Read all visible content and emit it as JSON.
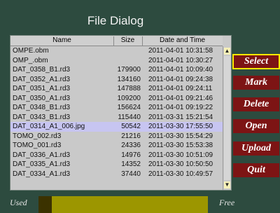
{
  "dialog": {
    "title": "File Dialog"
  },
  "table": {
    "headers": {
      "name": "Name",
      "size": "Size",
      "date": "Date and Time"
    },
    "rows": [
      {
        "name": "OMPE.obm",
        "size": "",
        "date": "2011-04-01 10:31:58"
      },
      {
        "name": "OMP_.obm",
        "size": "",
        "date": "2011-04-01 10:30:27"
      },
      {
        "name": "DAT_0358_B1.rd3",
        "size": "179900",
        "date": "2011-04-01 10:09:40"
      },
      {
        "name": "DAT_0352_A1.rd3",
        "size": "134160",
        "date": "2011-04-01 09:24:38"
      },
      {
        "name": "DAT_0351_A1.rd3",
        "size": "147888",
        "date": "2011-04-01 09:24:11"
      },
      {
        "name": "DAT_0350_A1.rd3",
        "size": "109200",
        "date": "2011-04-01 09:21:46"
      },
      {
        "name": "DAT_0348_B1.rd3",
        "size": "156624",
        "date": "2011-04-01 09:19:22"
      },
      {
        "name": "DAT_0343_B1.rd3",
        "size": "115440",
        "date": "2011-03-31 15:21:54"
      },
      {
        "name": "DAT_0314_A1_006.jpg",
        "size": "50542",
        "date": "2011-03-30 17:55:50"
      },
      {
        "name": "TOMO_002.rd3",
        "size": "21216",
        "date": "2011-03-30 15:54:29"
      },
      {
        "name": "TOMO_001.rd3",
        "size": "24336",
        "date": "2011-03-30 15:53:38"
      },
      {
        "name": "DAT_0336_A1.rd3",
        "size": "14976",
        "date": "2011-03-30 10:51:09"
      },
      {
        "name": "DAT_0335_A1.rd3",
        "size": "14352",
        "date": "2011-03-30 10:50:50"
      },
      {
        "name": "DAT_0334_A1.rd3",
        "size": "37440",
        "date": "2011-03-30 10:49:57"
      }
    ],
    "selected_index": 8
  },
  "buttons": {
    "select": "Select",
    "mark": "Mark",
    "delete": "Delete",
    "open": "Open",
    "upload": "Upload",
    "quit": "Quit"
  },
  "storage": {
    "used_label": "Used",
    "free_label": "Free",
    "used_fraction": 0.08
  },
  "colors": {
    "background": "#2d4b3f",
    "button": "#7d1414",
    "button_focus": "#ffe800",
    "selection": "#c7c5f1",
    "storage_used": "#3b3200",
    "storage_free": "#9c9600"
  },
  "icons": {
    "scroll_up": "triangle-up-icon",
    "scroll_down": "triangle-down-icon"
  }
}
